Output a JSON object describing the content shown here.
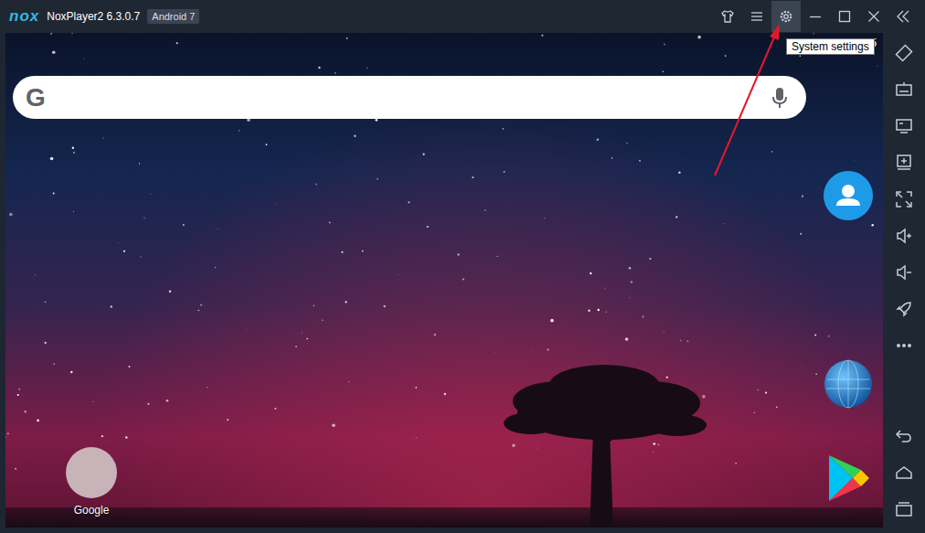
{
  "window": {
    "logo": "nox",
    "title": "NoxPlayer2 6.3.0.7",
    "badge": "Android 7"
  },
  "toolbar": [
    {
      "highlighted": false
    },
    {
      "highlighted": false
    },
    {
      "highlighted": true
    },
    {
      "highlighted": false
    },
    {
      "highlighted": false
    },
    {
      "highlighted": false
    },
    {
      "highlighted": false
    }
  ],
  "tooltip": {
    "text": "System settings"
  },
  "status_bar": {
    "time": "5"
  },
  "search": {
    "logo": "G"
  },
  "home_icons": [
    {
      "label": "Google"
    }
  ]
}
